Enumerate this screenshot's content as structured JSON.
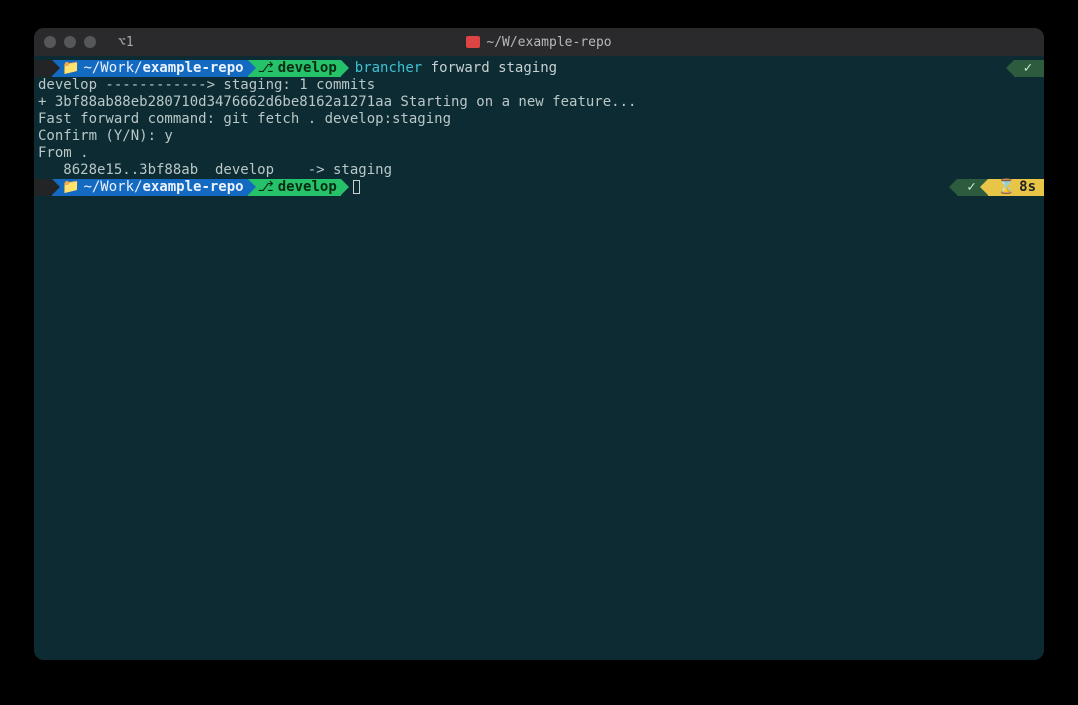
{
  "window": {
    "tab_label": "⌥1",
    "title": "~/W/example-repo"
  },
  "prompt1": {
    "apple_icon": "",
    "path_prefix": "~/Work/",
    "path_repo": "example-repo",
    "git_icon": "⎇",
    "branch": "develop",
    "command": "brancher",
    "args": "forward staging",
    "right_status_icon": "✓"
  },
  "output": {
    "line1": "develop ------------> staging: 1 commits",
    "line2": "+ 3bf88ab88eb280710d3476662d6be8162a1271aa Starting on a new feature...",
    "blank": "",
    "line3": "Fast forward command: git fetch . develop:staging",
    "line4": "Confirm (Y/N): y",
    "line5": "From .",
    "line6": "   8628e15..3bf88ab  develop    -> staging"
  },
  "prompt2": {
    "apple_icon": "",
    "path_prefix": "~/Work/",
    "path_repo": "example-repo",
    "git_icon": "⎇",
    "branch": "develop",
    "right_status_icon": "✓",
    "duration_icon": "⌛",
    "duration": "8s"
  }
}
